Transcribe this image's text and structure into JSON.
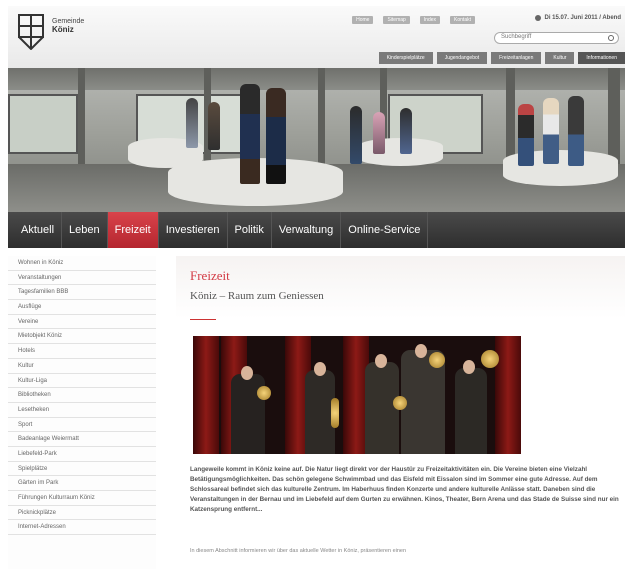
{
  "header": {
    "brand_line1": "Gemeinde",
    "brand_line2": "Köniz",
    "top_links": [
      "Home",
      "Sitemap",
      "Index",
      "Kontakt"
    ],
    "date_text": "Di 15.07. Juni 2011 / Abend",
    "search_placeholder": "Suchbegriff",
    "sub_links": [
      "Kinderspielplätze",
      "Jugendangebot",
      "Freizeitanlagen",
      "Kultur",
      "Informationen"
    ]
  },
  "main_nav": {
    "tabs": [
      "Aktuell",
      "Leben",
      "Freizeit",
      "Investieren",
      "Politik",
      "Verwaltung",
      "Online-Service"
    ],
    "active_index": 2
  },
  "sidebar": {
    "items": [
      "Wohnen in Köniz",
      "Veranstaltungen",
      "Tagesfamilien BBB",
      "Ausflüge",
      "Vereine",
      "Mietobjekt Köniz",
      "Hotels",
      "Kultur",
      "Kultur-Liga",
      "Bibliotheken",
      "Lesetheken",
      "Sport",
      "Badeanlage Weiermatt",
      "Liebefeld-Park",
      "Spielplätze",
      "Gärten im Park",
      "Führungen Kulturraum Köniz",
      "Picknickplätze",
      "Internet-Adressen"
    ]
  },
  "content": {
    "title": "Freizeit",
    "subtitle": "Köniz – Raum zum Geniessen",
    "lead": "Langeweile kommt in Köniz keine auf. Die Natur liegt direkt vor der Haustür zu Freizeitaktivitäten ein. Die Vereine bieten eine Vielzahl Betätigungsmöglichkeiten. Das schön gelegene Schwimmbad und das Eisfeld mit Eissalon sind im Sommer eine gute Adresse. Auf dem Schlossareal befindet sich das kulturelle Zentrum. Im Haberhuus finden Konzerte und andere kulturelle Anlässe statt. Daneben sind die Veranstaltungen in der Bernau und im Liebefeld auf dem Gurten zu erwähnen. Kinos, Theater, Bern Arena und das Stade de Suisse sind nur ein Katzensprung entfernt...",
    "more": "In diesem Abschnitt informieren wir über das aktuelle Wetter in Köniz, präsentieren einen"
  },
  "colors": {
    "accent": "#c2303a",
    "nav_dark": "#3a3a3a"
  }
}
